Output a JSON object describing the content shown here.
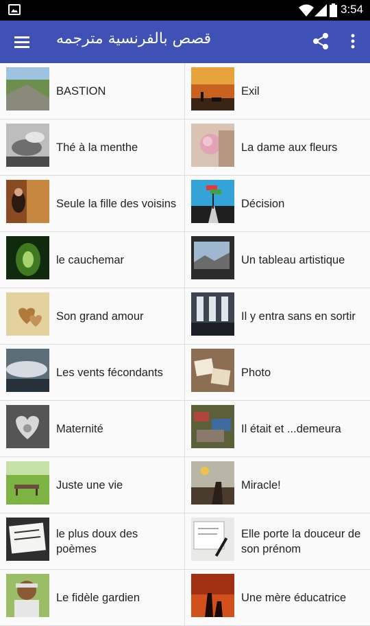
{
  "status_bar": {
    "time": "3:54"
  },
  "app_bar": {
    "title": "قصص بالفرنسية مترجمه",
    "icons": {
      "menu": "hamburger-menu-icon",
      "share": "share-icon",
      "more": "more-vert-icon"
    },
    "color": "#3f51b5"
  },
  "stories": [
    {
      "title": "BASTION",
      "thumb": "photo-landscape"
    },
    {
      "title": "Exil",
      "thumb": "photo-sunset-silhouette"
    },
    {
      "title": "Thé à la menthe",
      "thumb": "photo-tea-hands"
    },
    {
      "title": "La dame aux fleurs",
      "thumb": "photo-flowers-hand"
    },
    {
      "title": "Seule la fille des voisins",
      "thumb": "photo-girl-window"
    },
    {
      "title": "Décision",
      "thumb": "photo-road-signs"
    },
    {
      "title": "le cauchemar",
      "thumb": "photo-green-tunnel"
    },
    {
      "title": "Un tableau artistique",
      "thumb": "photo-painting"
    },
    {
      "title": "Son grand amour",
      "thumb": "photo-hearts"
    },
    {
      "title": "Il y entra sans en sortir",
      "thumb": "photo-doorways"
    },
    {
      "title": "Les vents fécondants",
      "thumb": "photo-clouds"
    },
    {
      "title": "Photo",
      "thumb": "photo-polaroids"
    },
    {
      "title": "Maternité",
      "thumb": "photo-heart-hands"
    },
    {
      "title": "Il était et ...demeura",
      "thumb": "photo-junk-pile"
    },
    {
      "title": "Juste une vie",
      "thumb": "photo-garden-bench"
    },
    {
      "title": "Miracle!",
      "thumb": "photo-dusk-figure"
    },
    {
      "title": "le plus doux des poèmes",
      "thumb": "photo-notebook"
    },
    {
      "title": "Elle porte la douceur de son prénom",
      "thumb": "photo-writing-desk"
    },
    {
      "title": "Le fidèle gardien",
      "thumb": "photo-child-portrait"
    },
    {
      "title": "Une mère éducatrice",
      "thumb": "photo-mother-child-sunset"
    }
  ]
}
